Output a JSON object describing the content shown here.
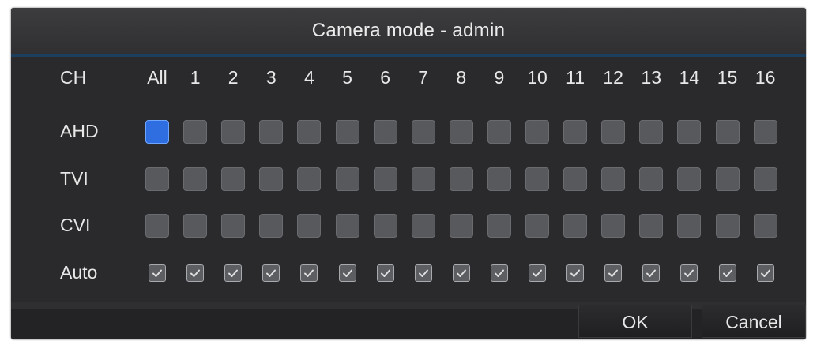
{
  "dialog": {
    "title": "Camera mode - admin"
  },
  "header": {
    "ch_label": "CH",
    "columns": [
      "All",
      "1",
      "2",
      "3",
      "4",
      "5",
      "6",
      "7",
      "8",
      "9",
      "10",
      "11",
      "12",
      "13",
      "14",
      "15",
      "16"
    ]
  },
  "rows": [
    {
      "label": "AHD",
      "type": "radio",
      "selected": 0
    },
    {
      "label": "TVI",
      "type": "radio",
      "selected": -1
    },
    {
      "label": "CVI",
      "type": "radio",
      "selected": -1
    },
    {
      "label": "Auto",
      "type": "checkbox",
      "checked": true
    }
  ],
  "buttons": {
    "ok": "OK",
    "cancel": "Cancel"
  },
  "colors": {
    "background": "#2a2a2c",
    "title_bar": "#353537",
    "accent_line": "#1b3f5c",
    "selected_box": "#2e6ee0",
    "unselected_box": "#58595d",
    "text": "#e8e8e8"
  }
}
